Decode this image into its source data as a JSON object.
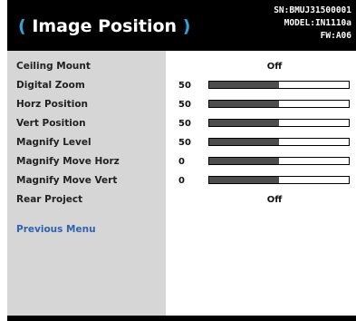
{
  "header": {
    "title": "Image Position",
    "sn": "SN:BMUJ31500001",
    "model": "MODEL:IN1110a",
    "fw": "FW:A06"
  },
  "menu": {
    "items": [
      {
        "label": "Ceiling Mount",
        "value": "Off"
      },
      {
        "label": "Digital Zoom",
        "number": "50",
        "level": 0.5
      },
      {
        "label": "Horz Position",
        "number": "50",
        "level": 0.5
      },
      {
        "label": "Vert Position",
        "number": "50",
        "level": 0.5
      },
      {
        "label": "Magnify Level",
        "number": "50",
        "level": 0.5
      },
      {
        "label": "Magnify Move Horz",
        "number": "0",
        "level": 0.5
      },
      {
        "label": "Magnify Move Vert",
        "number": "0",
        "level": 0.5
      },
      {
        "label": "Rear Project",
        "value": "Off"
      }
    ],
    "previous_label": "Previous Menu"
  },
  "colors": {
    "header_bg": "#000000",
    "paren_accent": "#29a8e0",
    "bar_fill": "#4d4d4d",
    "link": "#2f63b0"
  }
}
